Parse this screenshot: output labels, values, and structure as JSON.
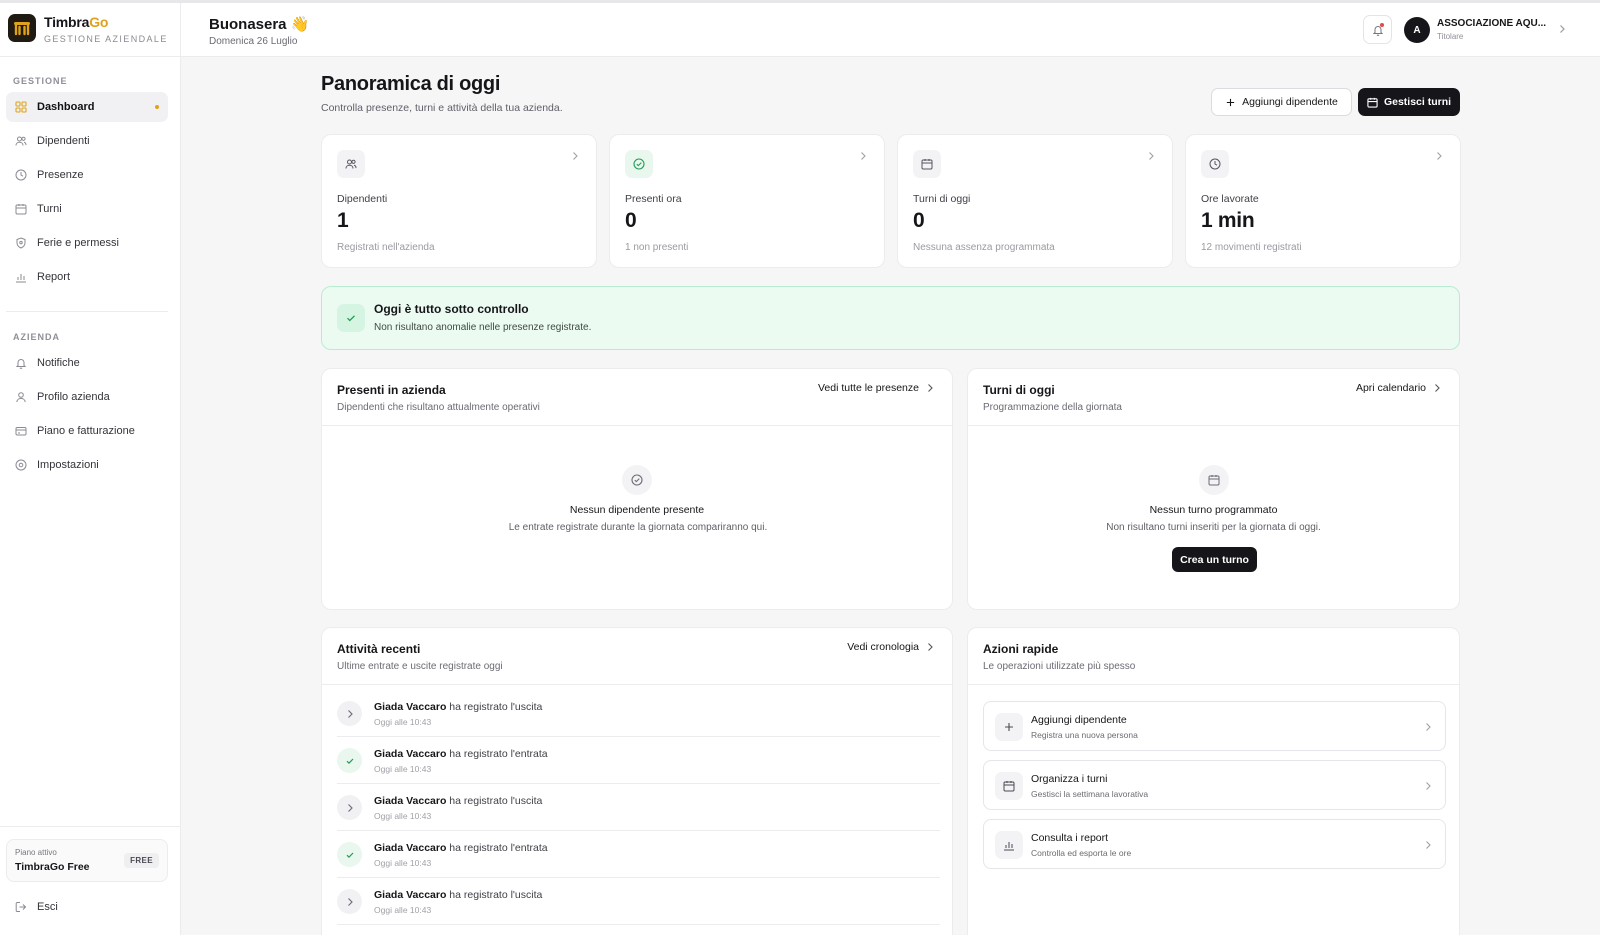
{
  "brand": {
    "name_main": "Timbra",
    "name_accent": "Go",
    "subtitle": "GESTIONE AZIENDALE"
  },
  "sidebar": {
    "section_gestione": "GESTIONE",
    "section_azienda": "AZIENDA",
    "items": [
      {
        "label": "Dashboard",
        "icon": "grid-icon",
        "active": true
      },
      {
        "label": "Dipendenti",
        "icon": "users-icon"
      },
      {
        "label": "Presenze",
        "icon": "clock-icon"
      },
      {
        "label": "Turni",
        "icon": "calendar-icon"
      },
      {
        "label": "Ferie e permessi",
        "icon": "shield-icon"
      }
    ],
    "report_label": "Report",
    "azienda_items": [
      {
        "label": "Notifiche",
        "icon": "bell-icon"
      },
      {
        "label": "Profilo azienda",
        "icon": "user-icon"
      },
      {
        "label": "Piano e fatturazione",
        "icon": "credit-card-icon"
      },
      {
        "label": "Impostazioni",
        "icon": "gear-icon"
      }
    ],
    "plan_label": "Piano attivo",
    "plan_name": "TimbraGo Free",
    "plan_badge": "FREE",
    "logout_label": "Esci"
  },
  "header": {
    "greeting": "Buonasera 👋",
    "date": "Domenica 26 Luglio",
    "avatar_initial": "A",
    "org_name": "ASSOCIAZIONE AQU...",
    "org_role": "Titolare"
  },
  "main": {
    "title": "Panoramica di oggi",
    "subtitle": "Controlla presenze, turni e attività della tua azienda.",
    "add_employee_button": "Aggiungi dipendente",
    "manage_shifts_button": "Gestisci turni"
  },
  "stats": [
    {
      "label": "Dipendenti",
      "value": "1",
      "sub": "Registrati nell'azienda",
      "icon": "users-icon"
    },
    {
      "label": "Presenti ora",
      "value": "0",
      "sub": "1 non presenti",
      "icon": "check-circle-icon"
    },
    {
      "label": "Turni di oggi",
      "value": "0",
      "sub": "Nessuna assenza programmata",
      "icon": "calendar-icon"
    },
    {
      "label": "Ore lavorate",
      "value": "1 min",
      "sub": "12 movimenti registrati",
      "icon": "clock-icon"
    }
  ],
  "banner": {
    "title": "Oggi è tutto sotto controllo",
    "subtitle": "Non risultano anomalie nelle presenze registrate.",
    "color": "#ecfbf2"
  },
  "present_panel": {
    "title": "Presenti in azienda",
    "subtitle": "Dipendenti che risultano attualmente operativi",
    "link": "Vedi tutte le presenze",
    "empty_title": "Nessun dipendente presente",
    "empty_sub": "Le entrate registrate durante la giornata compariranno qui."
  },
  "shifts_panel": {
    "title": "Turni di oggi",
    "subtitle": "Programmazione della giornata",
    "link": "Apri calendario",
    "empty_title": "Nessun turno programmato",
    "empty_sub": "Non risultano turni inseriti per la giornata di oggi.",
    "button": "Crea un turno"
  },
  "activity_panel": {
    "title": "Attività recenti",
    "subtitle": "Ultime entrate e uscite registrate oggi",
    "link": "Vedi cronologia",
    "rows": [
      {
        "name": "Giada Vaccaro",
        "action": " ha registrato l'uscita",
        "time": "Oggi alle 10:43",
        "type": "exit"
      },
      {
        "name": "Giada Vaccaro",
        "action": " ha registrato l'entrata",
        "time": "Oggi alle 10:43",
        "type": "entry"
      },
      {
        "name": "Giada Vaccaro",
        "action": " ha registrato l'uscita",
        "time": "Oggi alle 10:43",
        "type": "exit"
      },
      {
        "name": "Giada Vaccaro",
        "action": " ha registrato l'entrata",
        "time": "Oggi alle 10:43",
        "type": "entry"
      },
      {
        "name": "Giada Vaccaro",
        "action": " ha registrato l'uscita",
        "time": "Oggi alle 10:43",
        "type": "exit"
      }
    ]
  },
  "quick_panel": {
    "title": "Azioni rapide",
    "subtitle": "Le operazioni utilizzate più spesso",
    "items": [
      {
        "title": "Aggiungi dipendente",
        "sub": "Registra una nuova persona",
        "icon": "plus-icon"
      },
      {
        "title": "Organizza i turni",
        "sub": "Gestisci la settimana lavorativa",
        "icon": "calendar-icon"
      },
      {
        "title": "Consulta i report",
        "sub": "Controlla ed esporta le ore",
        "icon": "bar-chart-icon"
      }
    ]
  },
  "colors": {
    "accent": "#e0a21b",
    "dark": "#16161a",
    "success": "#1f9d55"
  }
}
